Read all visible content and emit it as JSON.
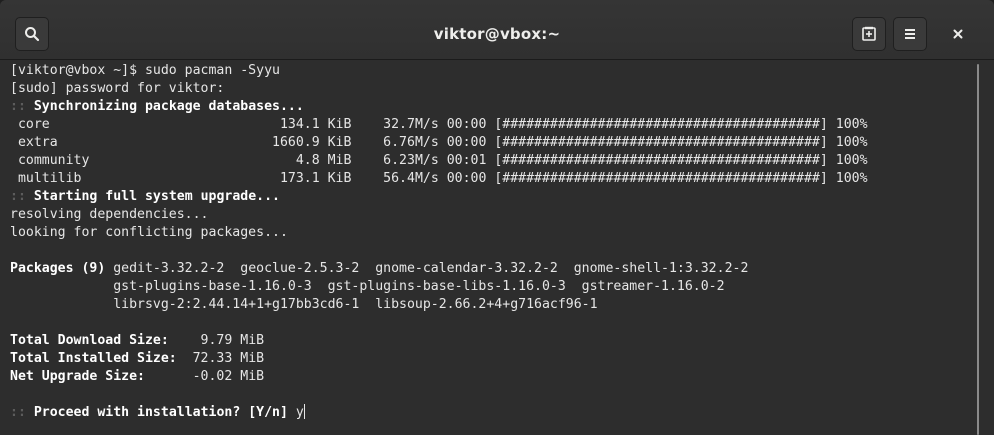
{
  "window": {
    "title": "viktor@vbox:~",
    "icons": {
      "search": "search-icon",
      "new_tab": "new-tab-icon",
      "menu": "hamburger-menu-icon",
      "close": "close-icon"
    }
  },
  "terminal": {
    "prompt_cmd": "[viktor@vbox ~]$ sudo pacman -Syyu",
    "sudo_prompt": "[sudo] password for viktor:",
    "sync_header": ":: Synchronizing package databases...",
    "sync_prefix": "::",
    "sync_text": "Synchronizing package databases...",
    "repos": [
      {
        "name": "core",
        "size": "134.1 KiB",
        "speed": "32.7M/s",
        "time": "00:00",
        "bar": "[########################################]",
        "pct": "100%"
      },
      {
        "name": "extra",
        "size": "1660.9 KiB",
        "speed": "6.76M/s",
        "time": "00:00",
        "bar": "[########################################]",
        "pct": "100%"
      },
      {
        "name": "community",
        "size": "4.8 MiB",
        "speed": "6.23M/s",
        "time": "00:01",
        "bar": "[########################################]",
        "pct": "100%"
      },
      {
        "name": "multilib",
        "size": "173.1 KiB",
        "speed": "56.4M/s",
        "time": "00:00",
        "bar": "[########################################]",
        "pct": "100%"
      }
    ],
    "upgrade_prefix": "::",
    "upgrade_text": "Starting full system upgrade...",
    "resolving": "resolving dependencies...",
    "conflicts": "looking for conflicting packages...",
    "packages_label": "Packages (9)",
    "packages_lines": [
      "gedit-3.32.2-2  geoclue-2.5.3-2  gnome-calendar-3.32.2-2  gnome-shell-1:3.32.2-2",
      "gst-plugins-base-1.16.0-3  gst-plugins-base-libs-1.16.0-3  gstreamer-1.16.0-2",
      "librsvg-2:2.44.14+1+g17bb3cd6-1  libsoup-2.66.2+4+g716acf96-1"
    ],
    "totals": [
      {
        "label": "Total Download Size:",
        "value": "9.79 MiB"
      },
      {
        "label": "Total Installed Size:",
        "value": "72.33 MiB"
      },
      {
        "label": "Net Upgrade Size:",
        "value": "-0.02 MiB"
      }
    ],
    "proceed_prefix": "::",
    "proceed_text": "Proceed with installation? [Y/n]",
    "input_value": "y"
  }
}
